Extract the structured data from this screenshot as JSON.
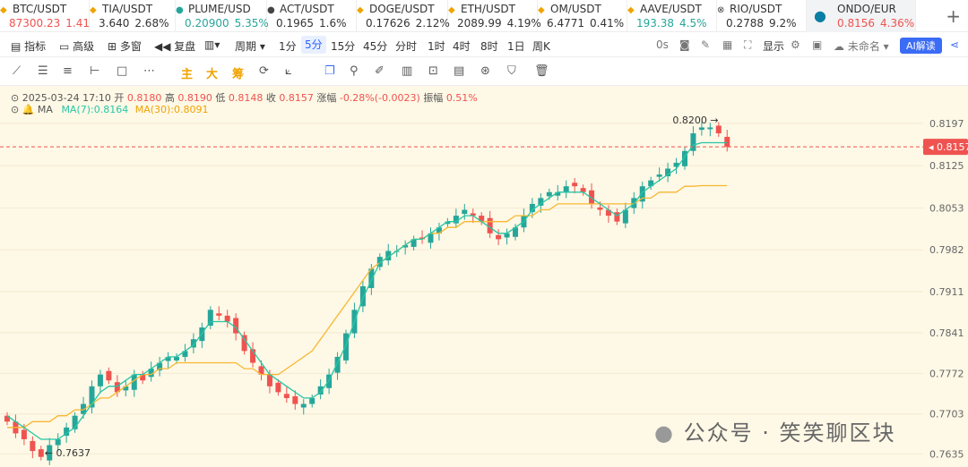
{
  "tickers": [
    {
      "icon": "btc-icon",
      "symbol": "BTC/USDT",
      "price": "87300.23",
      "change": "1.41",
      "dir": "down"
    },
    {
      "icon": "tia-icon",
      "symbol": "TIA/USDT",
      "price": "3.640",
      "change": "2.68%",
      "dir": "neutral"
    },
    {
      "icon": "plume-icon",
      "symbol": "PLUME/USD",
      "price": "0.20900",
      "change": "5.35%",
      "dir": "up"
    },
    {
      "icon": "act-icon",
      "symbol": "ACT/USDT",
      "price": "0.1965",
      "change": "1.6%",
      "dir": "neutral"
    },
    {
      "icon": "doge-icon",
      "symbol": "DOGE/USDT",
      "price": "0.17626",
      "change": "2.12%",
      "dir": "neutral"
    },
    {
      "icon": "eth-icon",
      "symbol": "ETH/USDT",
      "price": "2089.99",
      "change": "4.19%",
      "dir": "neutral"
    },
    {
      "icon": "om-icon",
      "symbol": "OM/USDT",
      "price": "6.4771",
      "change": "0.41%",
      "dir": "neutral"
    },
    {
      "icon": "aave-icon",
      "symbol": "AAVE/USDT",
      "price": "193.38",
      "change": "4.5%",
      "dir": "up"
    },
    {
      "icon": "rio-icon",
      "symbol": "RIO/USDT",
      "price": "0.2788",
      "change": "9.2%",
      "dir": "neutral"
    },
    {
      "icon": "ondo-icon",
      "symbol": "ONDO/EUR",
      "price": "0.8156",
      "change": "4.36%",
      "dir": "down",
      "active": true
    }
  ],
  "toolbar": {
    "indicators": "指标",
    "advanced": "高级",
    "multi_window": "多窗",
    "replay": "复盘",
    "period": "周期",
    "intervals": [
      "1分",
      "5分",
      "15分",
      "45分",
      "分时",
      "1时",
      "4时",
      "8时",
      "1日",
      "周K"
    ],
    "active_interval": "5分",
    "countdown": "0s",
    "display": "显示",
    "unnamed": "未命名",
    "ai": "AI解读"
  },
  "drawbar": {
    "main": "主",
    "big": "大",
    "chip": "筹"
  },
  "info": {
    "datetime": "2025-03-24 17:10",
    "open_label": "开",
    "open": "0.8180",
    "high_label": "高",
    "high": "0.8190",
    "low_label": "低",
    "low": "0.8148",
    "close_label": "收",
    "close": "0.8157",
    "change_label": "涨幅",
    "change": "-0.28%(-0.0023)",
    "amplitude_label": "振幅",
    "amplitude": "0.51%"
  },
  "ma": {
    "name": "MA",
    "ma7": "MA(7):0.8164",
    "ma30": "MA(30):0.8091"
  },
  "colors": {
    "up": "#26a69a",
    "down": "#ef5350",
    "ma7": "#26c6a6",
    "ma30": "#f7b731",
    "bg": "#fef8e6"
  },
  "watermark": "公众号 · 笑笑聊区块",
  "chart_data": {
    "type": "candlestick",
    "y_ticks": [
      "0.8197",
      "0.8125",
      "0.8053",
      "0.7982",
      "0.7911",
      "0.7841",
      "0.7772",
      "0.7703",
      "0.7635"
    ],
    "ylim": [
      0.7625,
      0.8215
    ],
    "current_price": "0.8157",
    "high_label": "0.8200",
    "low_label": "0.7637",
    "close": [
      0.769,
      0.767,
      0.766,
      0.764,
      0.763,
      0.765,
      0.766,
      0.768,
      0.77,
      0.772,
      0.775,
      0.777,
      0.776,
      0.774,
      0.775,
      0.777,
      0.776,
      0.778,
      0.779,
      0.78,
      0.78,
      0.781,
      0.783,
      0.785,
      0.788,
      0.787,
      0.786,
      0.784,
      0.781,
      0.779,
      0.777,
      0.775,
      0.774,
      0.773,
      0.772,
      0.772,
      0.773,
      0.775,
      0.777,
      0.78,
      0.784,
      0.788,
      0.792,
      0.795,
      0.797,
      0.798,
      0.798,
      0.799,
      0.8,
      0.8,
      0.801,
      0.802,
      0.803,
      0.804,
      0.805,
      0.804,
      0.803,
      0.801,
      0.8,
      0.801,
      0.802,
      0.804,
      0.806,
      0.807,
      0.808,
      0.808,
      0.809,
      0.809,
      0.808,
      0.806,
      0.805,
      0.804,
      0.803,
      0.805,
      0.807,
      0.809,
      0.81,
      0.811,
      0.812,
      0.813,
      0.815,
      0.818,
      0.819,
      0.819,
      0.818,
      0.8157
    ],
    "ma7": [
      0.77,
      0.769,
      0.768,
      0.767,
      0.766,
      0.766,
      0.766,
      0.767,
      0.768,
      0.77,
      0.772,
      0.774,
      0.775,
      0.775,
      0.776,
      0.777,
      0.777,
      0.778,
      0.779,
      0.78,
      0.78,
      0.781,
      0.782,
      0.784,
      0.786,
      0.786,
      0.786,
      0.785,
      0.783,
      0.781,
      0.779,
      0.777,
      0.776,
      0.775,
      0.774,
      0.773,
      0.773,
      0.774,
      0.776,
      0.779,
      0.782,
      0.786,
      0.79,
      0.793,
      0.796,
      0.797,
      0.798,
      0.799,
      0.8,
      0.8,
      0.801,
      0.802,
      0.803,
      0.803,
      0.804,
      0.804,
      0.803,
      0.802,
      0.801,
      0.801,
      0.802,
      0.803,
      0.805,
      0.806,
      0.807,
      0.808,
      0.808,
      0.808,
      0.808,
      0.807,
      0.806,
      0.805,
      0.804,
      0.805,
      0.806,
      0.808,
      0.809,
      0.81,
      0.811,
      0.812,
      0.814,
      0.816,
      0.8164,
      0.8164,
      0.8164,
      0.8164
    ],
    "ma30": [
      0.768,
      0.768,
      0.768,
      0.769,
      0.769,
      0.769,
      0.77,
      0.77,
      0.771,
      0.771,
      0.772,
      0.773,
      0.773,
      0.774,
      0.775,
      0.776,
      0.777,
      0.777,
      0.778,
      0.778,
      0.779,
      0.779,
      0.779,
      0.779,
      0.779,
      0.779,
      0.779,
      0.779,
      0.778,
      0.778,
      0.777,
      0.777,
      0.777,
      0.778,
      0.779,
      0.78,
      0.781,
      0.783,
      0.785,
      0.787,
      0.789,
      0.791,
      0.793,
      0.795,
      0.796,
      0.797,
      0.798,
      0.799,
      0.8,
      0.8,
      0.801,
      0.801,
      0.802,
      0.802,
      0.803,
      0.803,
      0.803,
      0.803,
      0.803,
      0.803,
      0.804,
      0.804,
      0.804,
      0.805,
      0.805,
      0.806,
      0.806,
      0.806,
      0.806,
      0.806,
      0.806,
      0.806,
      0.806,
      0.806,
      0.806,
      0.807,
      0.807,
      0.808,
      0.808,
      0.808,
      0.809,
      0.809,
      0.8091,
      0.8091,
      0.8091,
      0.8091
    ]
  }
}
